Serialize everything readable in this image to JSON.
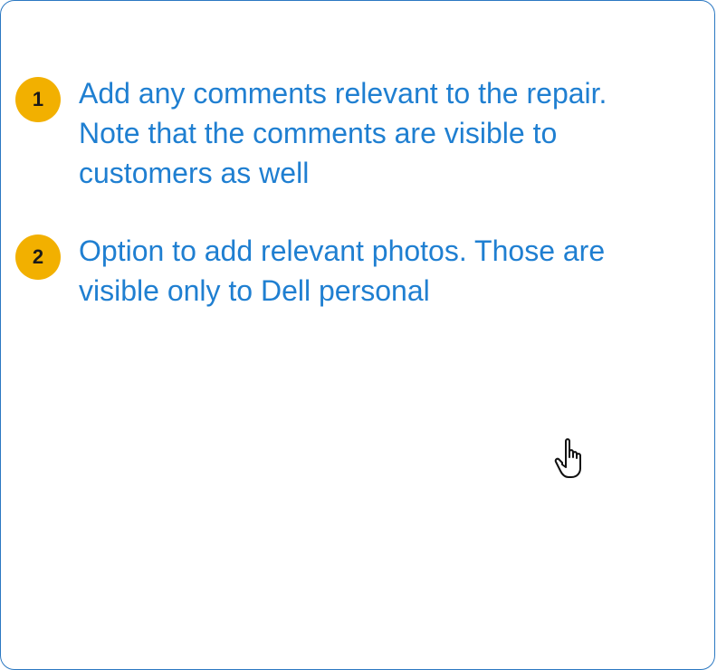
{
  "steps": [
    {
      "number": "1",
      "text": "Add any comments relevant to the repair. Note that the comments are visible to customers as well"
    },
    {
      "number": "2",
      "text": "Option to add relevant photos. Those are visible only to Dell personal"
    }
  ],
  "colors": {
    "border": "#2b78c2",
    "text": "#1f7fd1",
    "badge": "#f2b000"
  },
  "icons": {
    "cursor": "hand-pointer-icon"
  }
}
